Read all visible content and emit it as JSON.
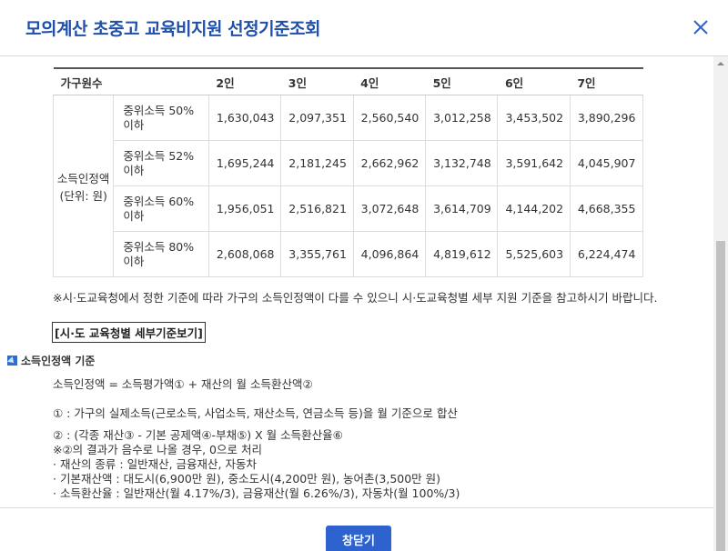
{
  "modal": {
    "title": "모의계산 초중고 교육비지원 선정기준조회"
  },
  "table": {
    "headers": [
      "가구원수",
      "",
      "2인",
      "3인",
      "4인",
      "5인",
      "6인",
      "7인"
    ],
    "row_header": "소득인정액 (단위: 원)",
    "rows": [
      {
        "label": "중위소득 50% 이하",
        "values": [
          "1,630,043",
          "2,097,351",
          "2,560,540",
          "3,012,258",
          "3,453,502",
          "3,890,296"
        ]
      },
      {
        "label": "중위소득 52% 이하",
        "values": [
          "1,695,244",
          "2,181,245",
          "2,662,962",
          "3,132,748",
          "3,591,642",
          "4,045,907"
        ]
      },
      {
        "label": "중위소득 60% 이하",
        "values": [
          "1,956,051",
          "2,516,821",
          "3,072,648",
          "3,614,709",
          "4,144,202",
          "4,668,355"
        ]
      },
      {
        "label": "중위소득 80% 이하",
        "values": [
          "2,608,068",
          "3,355,761",
          "4,096,864",
          "4,819,612",
          "5,525,603",
          "6,224,474"
        ]
      }
    ]
  },
  "note": "※시·도교육청에서 정한 기준에 따라 가구의 소득인정액이 다를 수 있으니 시·도교육청별 세부 지원 기준을 참고하시기 바랍니다.",
  "link_label": "[시·도 교육청별 세부기준보기]",
  "section": {
    "title": "소득인정액 기준",
    "formula": "소득인정액 = 소득평가액① + 재산의 월 소득환산액②",
    "line1": "① : 가구의 실제소득(근로소득, 사업소득, 재산소득, 연금소득 등)을 월 기준으로 합산",
    "line2": "② : (각종 재산③ - 기본 공제액④-부채⑤) X 월 소득환산율⑥",
    "line3": "※②의 결과가 음수로 나올 경우, 0으로 처리",
    "line4": "· 재산의 종류 : 일반재산, 금융재산, 자동차",
    "line5": "· 기본재산액 : 대도시(6,900만 원), 중소도시(4,200만 원), 농어촌(3,500만 원)",
    "line6": "· 소득환산율 : 일반재산(월 4.17%/3), 금융재산(월 6.26%/3), 자동차(월 100%/3)"
  },
  "footer": {
    "close_label": "창닫기"
  },
  "colors": {
    "accent": "#2e63cf",
    "title": "#1f4fa8"
  }
}
